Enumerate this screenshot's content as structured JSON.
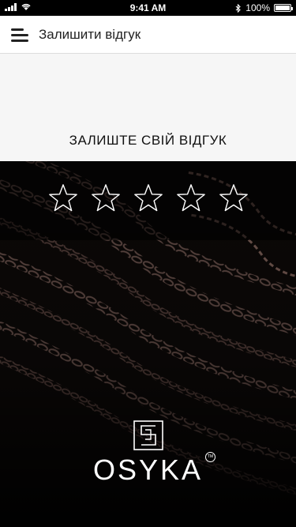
{
  "status_bar": {
    "time": "9:41 AM",
    "battery": "100%",
    "icons": [
      "signal-icon",
      "wifi-icon",
      "bluetooth-icon",
      "battery-icon"
    ]
  },
  "header": {
    "menu_icon": "hamburger-menu-icon",
    "title": "Залишити відгук"
  },
  "review": {
    "prompt": "ЗАЛИШТЕ СВІЙ ВІДГУК",
    "rating": 0,
    "max_rating": 5,
    "star_color": "#ffffff"
  },
  "brand": {
    "name": "OSYKA",
    "trademark": "TM"
  },
  "colors": {
    "header_bg": "#ffffff",
    "prompt_bg": "#f6f6f6",
    "hero_bg": "#0b0807"
  }
}
